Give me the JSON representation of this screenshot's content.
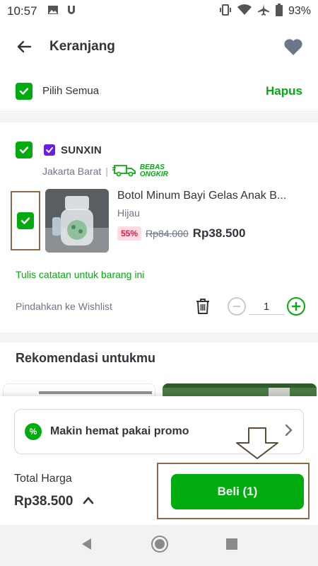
{
  "status_bar": {
    "time": "10:57",
    "battery": "93%"
  },
  "header": {
    "title": "Keranjang"
  },
  "select_all": {
    "label": "Pilih Semua",
    "delete_label": "Hapus"
  },
  "shop": {
    "name": "SUNXIN",
    "location": "Jakarta Barat",
    "free_shipping_line1": "BEBAS",
    "free_shipping_line2": "ONGKIR"
  },
  "product": {
    "name": "Botol Minum Bayi Gelas Anak B...",
    "variant": "Hijau",
    "discount": "55%",
    "original_price": "Rp84.000",
    "price": "Rp38.500",
    "quantity": "1"
  },
  "actions": {
    "note_link": "Tulis catatan untuk barang ini",
    "move_to_wishlist": "Pindahkan ke Wishlist"
  },
  "recommendations": {
    "title": "Rekomendasi untukmu"
  },
  "promo": {
    "label": "Makin hemat pakai promo"
  },
  "checkout": {
    "total_label": "Total Harga",
    "total_value": "Rp38.500",
    "buy_label": "Beli (1)"
  },
  "colors": {
    "primary": "#03ac0e",
    "annotation": "#8b6b43",
    "discount_bg": "#ffdbe2",
    "discount_text": "#ef144a"
  }
}
